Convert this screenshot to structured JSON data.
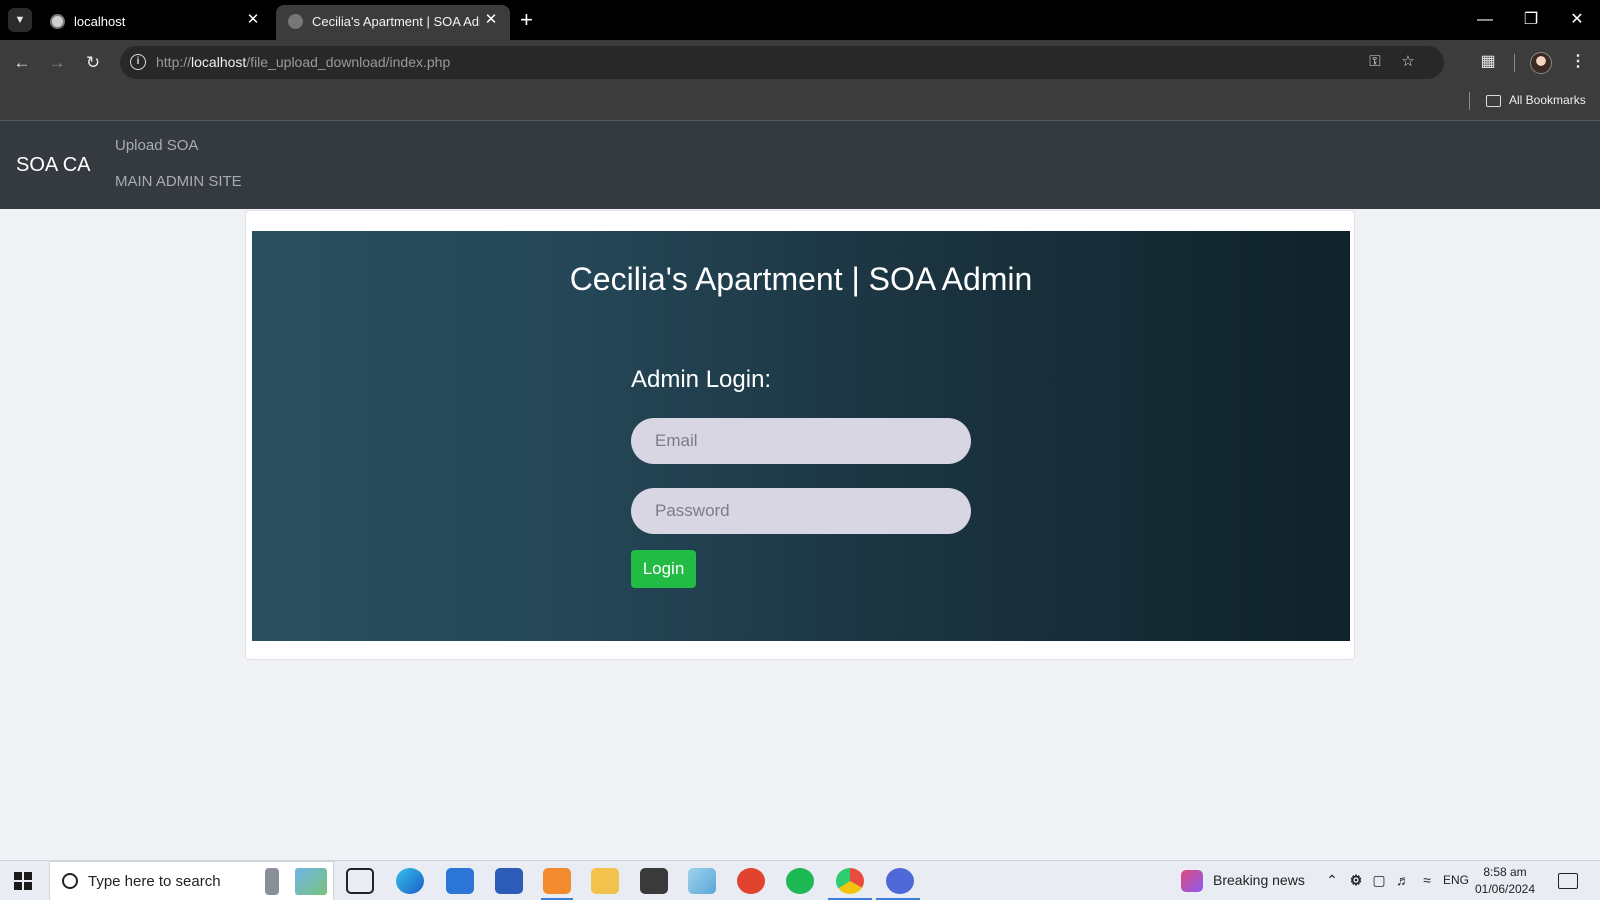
{
  "browser": {
    "tabs": [
      {
        "title": "localhost"
      },
      {
        "title": "Cecilia's Apartment | SOA Admin"
      }
    ],
    "url_prefix": "http://",
    "url_host": "localhost",
    "url_path": "/file_upload_download/index.php",
    "bookmarks_label": "All Bookmarks"
  },
  "site_nav": {
    "brand": "SOA CA",
    "links": [
      {
        "label": "Upload SOA"
      },
      {
        "label": "MAIN ADMIN SITE"
      }
    ]
  },
  "hero": {
    "title": "Cecilia's Apartment | SOA Admin",
    "form_heading": "Admin Login:",
    "email_placeholder": "Email",
    "password_placeholder": "Password",
    "login_label": "Login"
  },
  "taskbar": {
    "search_placeholder": "Type here to search",
    "news_label": "Breaking news",
    "language": "ENG",
    "time": "8:58 am",
    "date": "01/06/2024",
    "apps": [
      "task-view-icon",
      "edge-icon",
      "mail-icon",
      "word-icon",
      "xampp-icon",
      "file-explorer-icon",
      "sublime-text-icon",
      "notepad-icon",
      "wps-office-icon",
      "spotify-icon",
      "chrome-icon",
      "chrome-dev-icon"
    ]
  },
  "colors": {
    "site_nav_bg": "#343a40",
    "hero_gradient_start": "#2a4f5f",
    "hero_gradient_end": "#10222a",
    "login_button": "#22bb44",
    "input_bg": "#d8d6e2"
  }
}
